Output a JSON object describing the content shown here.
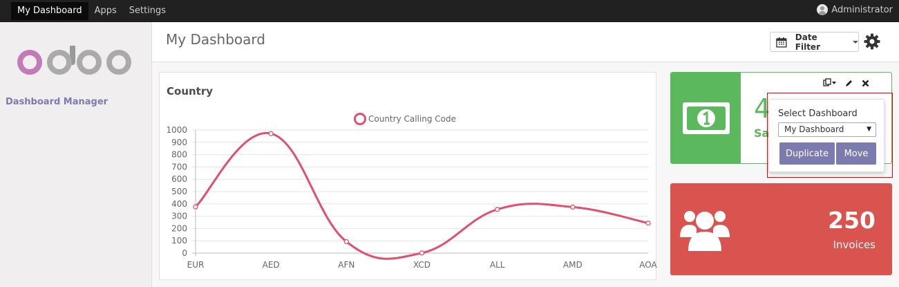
{
  "topbar": {
    "menu": [
      "My Dashboard",
      "Apps",
      "Settings"
    ],
    "user": "Administrator"
  },
  "sidebar": {
    "logo_text": "odoo",
    "app_name": "Dashboard Manager"
  },
  "control_panel": {
    "title": "My Dashboard",
    "date_filter": "Date Filter"
  },
  "chart_card": {
    "title": "Country"
  },
  "chart_data": {
    "type": "line",
    "title": "Country",
    "categories": [
      "EUR",
      "AED",
      "AFN",
      "XCD",
      "ALL",
      "AMD",
      "AOA"
    ],
    "series": [
      {
        "name": "Country Calling Code",
        "values": [
          376,
          971,
          93,
          1,
          355,
          374,
          244
        ]
      }
    ],
    "yticks": [
      "0",
      "100",
      "200",
      "300",
      "400",
      "500",
      "600",
      "700",
      "800",
      "900",
      "1000"
    ],
    "ylim": [
      0,
      1000
    ],
    "legend": "top",
    "grid": true,
    "color": "#e0506e"
  },
  "tiles": {
    "green": {
      "value": "4",
      "label": "Sa",
      "color": "#5cb85c",
      "icon": "money-icon"
    },
    "red": {
      "value": "250",
      "label": "Invoices",
      "color": "#d9534f",
      "icon": "users-icon"
    }
  },
  "popover": {
    "label": "Select Dashboard",
    "selected": "My Dashboard",
    "duplicate": "Duplicate",
    "move": "Move"
  }
}
